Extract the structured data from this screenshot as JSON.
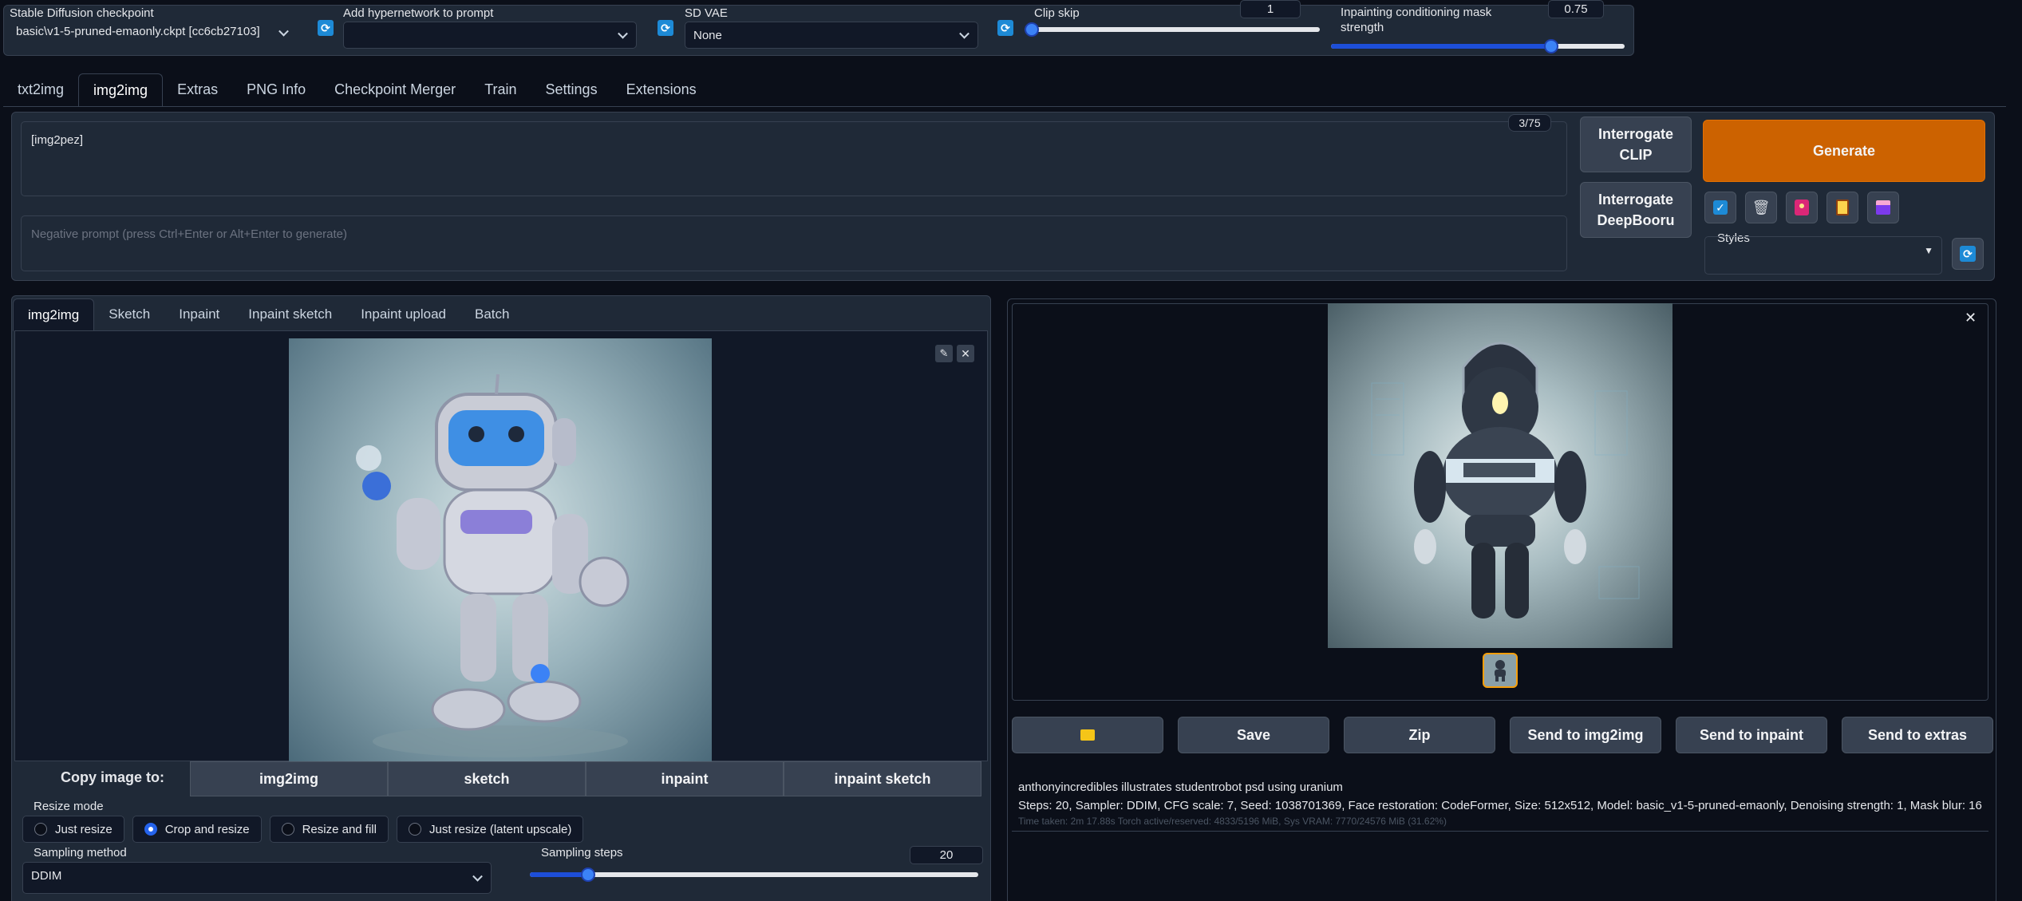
{
  "top": {
    "checkpoint": {
      "label": "Stable Diffusion checkpoint",
      "value": "basic\\v1-5-pruned-emaonly.ckpt [cc6cb27103]"
    },
    "hypernetwork": {
      "label": "Add hypernetwork to prompt",
      "value": ""
    },
    "vae": {
      "label": "SD VAE",
      "value": "None"
    },
    "clip_skip": {
      "label": "Clip skip",
      "value": "1",
      "level": 0.0
    },
    "mask_strength": {
      "label": "Inpainting conditioning mask strength",
      "value": "0.75",
      "level": 0.75
    }
  },
  "tabs": [
    "txt2img",
    "img2img",
    "Extras",
    "PNG Info",
    "Checkpoint Merger",
    "Train",
    "Settings",
    "Extensions"
  ],
  "prompt": {
    "value": "[img2pez]",
    "token_count": "3/75",
    "negative_placeholder": "Negative prompt (press Ctrl+Enter or Alt+Enter to generate)"
  },
  "buttons": {
    "interrogate_clip": "Interrogate CLIP",
    "interrogate_deepbooru": "Interrogate DeepBooru",
    "generate": "Generate",
    "styles_label": "Styles"
  },
  "subtabs": [
    "img2img",
    "Sketch",
    "Inpaint",
    "Inpaint sketch",
    "Inpaint upload",
    "Batch"
  ],
  "copy_to": {
    "label": "Copy image to:",
    "buttons": [
      "img2img",
      "sketch",
      "inpaint",
      "inpaint sketch"
    ]
  },
  "resize": {
    "label": "Resize mode",
    "options": [
      "Just resize",
      "Crop and resize",
      "Resize and fill",
      "Just resize (latent upscale)"
    ],
    "selected": 1
  },
  "sampling": {
    "method_label": "Sampling method",
    "method_value": "DDIM",
    "steps_label": "Sampling steps",
    "steps_value": "20",
    "steps_level": 0.13
  },
  "output_buttons": [
    "Save",
    "Zip",
    "Send to img2img",
    "Send to inpaint",
    "Send to extras"
  ],
  "output": {
    "prompt": "anthonyincredibles illustrates studentrobot psd using uranium",
    "params": "Steps: 20, Sampler: DDIM, CFG scale: 7, Seed: 1038701369, Face restoration: CodeFormer, Size: 512x512, Model: basic_v1-5-pruned-emaonly, Denoising strength: 1, Mask blur: 16",
    "time": "Time taken: 2m 17.88s  Torch active/reserved: 4833/5196 MiB, Sys VRAM: 7770/24576 MiB (31.62%)"
  },
  "colors": {
    "accent": "#2563eb",
    "generate": "#cc6200",
    "bg": "#0b0f19"
  }
}
